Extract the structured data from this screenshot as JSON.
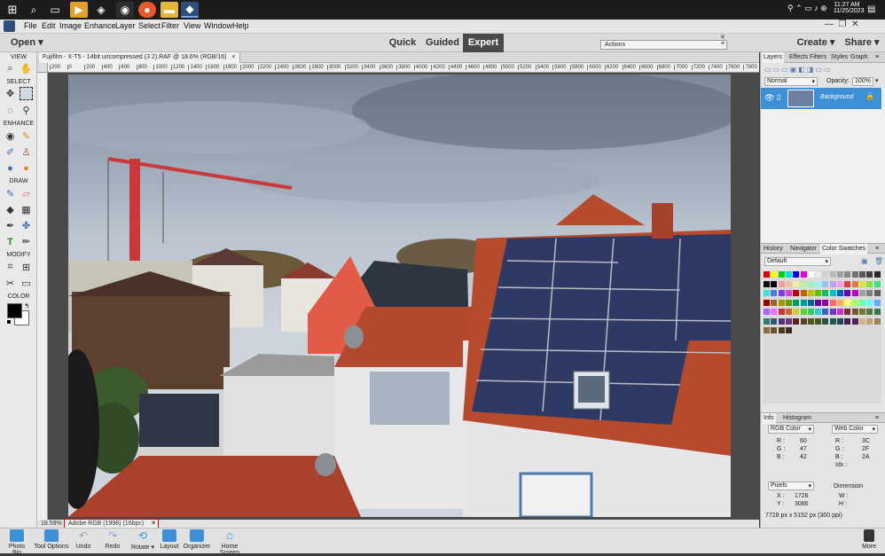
{
  "taskbar": {
    "time": "11:27 AM",
    "date": "11/25/2023"
  },
  "menu": [
    "File",
    "Edit",
    "Image",
    "Enhance",
    "Layer",
    "Select",
    "Filter",
    "View",
    "Window",
    "Help"
  ],
  "modebar": {
    "open": "Open",
    "modes": [
      "Quick",
      "Guided",
      "Expert"
    ],
    "active_mode": "Expert",
    "actions_panel": "Actions",
    "create": "Create",
    "share": "Share"
  },
  "toolbox": {
    "sections": [
      "VIEW",
      "SELECT",
      "ENHANCE",
      "DRAW",
      "MODIFY",
      "COLOR"
    ]
  },
  "document": {
    "tab_title": "Fujifilm - X-T5 - 14bit uncompressed (3 2).RAF @ 18.6% (RGB/16)",
    "close": "×",
    "ruler_ticks": [
      "200",
      "0",
      "200",
      "400",
      "600",
      "800",
      "1000",
      "1200",
      "1400",
      "1600",
      "1800",
      "2000",
      "2200",
      "2400",
      "2600",
      "2800",
      "3000",
      "3200",
      "3400",
      "3600",
      "3800",
      "4000",
      "4200",
      "4400",
      "4600",
      "4800",
      "5000",
      "5200",
      "5400",
      "5600",
      "5800",
      "6000",
      "6200",
      "6400",
      "6600",
      "6800",
      "7000",
      "7200",
      "7400",
      "7600",
      "7800"
    ],
    "zoom": "18.59%",
    "profile": "Adobe RGB (1998) (16bpc)"
  },
  "panels": {
    "tabs_top": [
      "Layers",
      "Effects",
      "Filters",
      "Styles",
      "Graphics"
    ],
    "blend_mode": "Normal",
    "opacity_label": "Opacity:",
    "opacity_value": "100%",
    "layer_name": "Background",
    "tabs_mid": [
      "History",
      "Navigator",
      "Color Swatches"
    ],
    "swatch_set": "Default",
    "tabs_info": [
      "Info",
      "Histogram"
    ],
    "rgb_mode": "RGB Color",
    "web_mode": "Web Color",
    "r_label": "R :",
    "r_value": "60",
    "g_label": "G :",
    "g_value": "47",
    "b_label": "B :",
    "b_value": "42",
    "wr_label": "R :",
    "wr_value": "3C",
    "wg_label": "G :",
    "wg_value": "2F",
    "wb_label": "B :",
    "wb_value": "2A",
    "idx_label": "Idx :",
    "units": "Pixels",
    "x_label": "X :",
    "x_value": "1726",
    "y_label": "Y :",
    "y_value": "3086",
    "dimension": "Dimension",
    "w_label": "W :",
    "h_label": "H :",
    "doc_size": "7728 px x 5152 px (300 ppi)"
  },
  "bottombar": {
    "left": [
      "Photo Bin",
      "Tool Options",
      "Undo",
      "Redo",
      "Rotate",
      "Layout",
      "Organizer",
      "Home Screen"
    ],
    "more": "More"
  },
  "colors": {
    "accent": "#3d8fd6",
    "expert_bg": "#4a4a4a",
    "highlight_red": "#e00000"
  }
}
